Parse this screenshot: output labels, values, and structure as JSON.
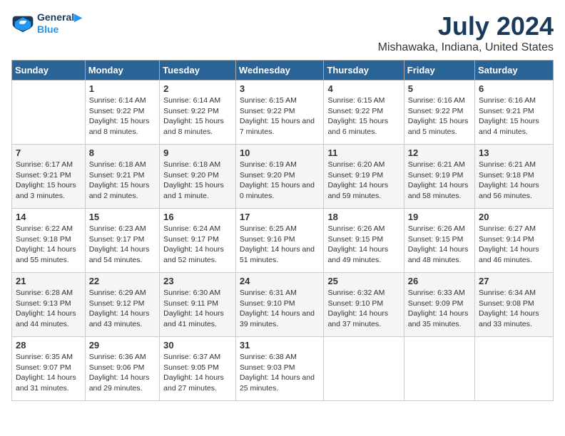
{
  "logo": {
    "line1": "General",
    "line2": "Blue"
  },
  "title": "July 2024",
  "subtitle": "Mishawaka, Indiana, United States",
  "days_header": [
    "Sunday",
    "Monday",
    "Tuesday",
    "Wednesday",
    "Thursday",
    "Friday",
    "Saturday"
  ],
  "weeks": [
    [
      {
        "day": "",
        "info": ""
      },
      {
        "day": "1",
        "info": "Sunrise: 6:14 AM\nSunset: 9:22 PM\nDaylight: 15 hours\nand 8 minutes."
      },
      {
        "day": "2",
        "info": "Sunrise: 6:14 AM\nSunset: 9:22 PM\nDaylight: 15 hours\nand 8 minutes."
      },
      {
        "day": "3",
        "info": "Sunrise: 6:15 AM\nSunset: 9:22 PM\nDaylight: 15 hours\nand 7 minutes."
      },
      {
        "day": "4",
        "info": "Sunrise: 6:15 AM\nSunset: 9:22 PM\nDaylight: 15 hours\nand 6 minutes."
      },
      {
        "day": "5",
        "info": "Sunrise: 6:16 AM\nSunset: 9:22 PM\nDaylight: 15 hours\nand 5 minutes."
      },
      {
        "day": "6",
        "info": "Sunrise: 6:16 AM\nSunset: 9:21 PM\nDaylight: 15 hours\nand 4 minutes."
      }
    ],
    [
      {
        "day": "7",
        "info": "Sunrise: 6:17 AM\nSunset: 9:21 PM\nDaylight: 15 hours\nand 3 minutes."
      },
      {
        "day": "8",
        "info": "Sunrise: 6:18 AM\nSunset: 9:21 PM\nDaylight: 15 hours\nand 2 minutes."
      },
      {
        "day": "9",
        "info": "Sunrise: 6:18 AM\nSunset: 9:20 PM\nDaylight: 15 hours\nand 1 minute."
      },
      {
        "day": "10",
        "info": "Sunrise: 6:19 AM\nSunset: 9:20 PM\nDaylight: 15 hours\nand 0 minutes."
      },
      {
        "day": "11",
        "info": "Sunrise: 6:20 AM\nSunset: 9:19 PM\nDaylight: 14 hours\nand 59 minutes."
      },
      {
        "day": "12",
        "info": "Sunrise: 6:21 AM\nSunset: 9:19 PM\nDaylight: 14 hours\nand 58 minutes."
      },
      {
        "day": "13",
        "info": "Sunrise: 6:21 AM\nSunset: 9:18 PM\nDaylight: 14 hours\nand 56 minutes."
      }
    ],
    [
      {
        "day": "14",
        "info": "Sunrise: 6:22 AM\nSunset: 9:18 PM\nDaylight: 14 hours\nand 55 minutes."
      },
      {
        "day": "15",
        "info": "Sunrise: 6:23 AM\nSunset: 9:17 PM\nDaylight: 14 hours\nand 54 minutes."
      },
      {
        "day": "16",
        "info": "Sunrise: 6:24 AM\nSunset: 9:17 PM\nDaylight: 14 hours\nand 52 minutes."
      },
      {
        "day": "17",
        "info": "Sunrise: 6:25 AM\nSunset: 9:16 PM\nDaylight: 14 hours\nand 51 minutes."
      },
      {
        "day": "18",
        "info": "Sunrise: 6:26 AM\nSunset: 9:15 PM\nDaylight: 14 hours\nand 49 minutes."
      },
      {
        "day": "19",
        "info": "Sunrise: 6:26 AM\nSunset: 9:15 PM\nDaylight: 14 hours\nand 48 minutes."
      },
      {
        "day": "20",
        "info": "Sunrise: 6:27 AM\nSunset: 9:14 PM\nDaylight: 14 hours\nand 46 minutes."
      }
    ],
    [
      {
        "day": "21",
        "info": "Sunrise: 6:28 AM\nSunset: 9:13 PM\nDaylight: 14 hours\nand 44 minutes."
      },
      {
        "day": "22",
        "info": "Sunrise: 6:29 AM\nSunset: 9:12 PM\nDaylight: 14 hours\nand 43 minutes."
      },
      {
        "day": "23",
        "info": "Sunrise: 6:30 AM\nSunset: 9:11 PM\nDaylight: 14 hours\nand 41 minutes."
      },
      {
        "day": "24",
        "info": "Sunrise: 6:31 AM\nSunset: 9:10 PM\nDaylight: 14 hours\nand 39 minutes."
      },
      {
        "day": "25",
        "info": "Sunrise: 6:32 AM\nSunset: 9:10 PM\nDaylight: 14 hours\nand 37 minutes."
      },
      {
        "day": "26",
        "info": "Sunrise: 6:33 AM\nSunset: 9:09 PM\nDaylight: 14 hours\nand 35 minutes."
      },
      {
        "day": "27",
        "info": "Sunrise: 6:34 AM\nSunset: 9:08 PM\nDaylight: 14 hours\nand 33 minutes."
      }
    ],
    [
      {
        "day": "28",
        "info": "Sunrise: 6:35 AM\nSunset: 9:07 PM\nDaylight: 14 hours\nand 31 minutes."
      },
      {
        "day": "29",
        "info": "Sunrise: 6:36 AM\nSunset: 9:06 PM\nDaylight: 14 hours\nand 29 minutes."
      },
      {
        "day": "30",
        "info": "Sunrise: 6:37 AM\nSunset: 9:05 PM\nDaylight: 14 hours\nand 27 minutes."
      },
      {
        "day": "31",
        "info": "Sunrise: 6:38 AM\nSunset: 9:03 PM\nDaylight: 14 hours\nand 25 minutes."
      },
      {
        "day": "",
        "info": ""
      },
      {
        "day": "",
        "info": ""
      },
      {
        "day": "",
        "info": ""
      }
    ]
  ]
}
